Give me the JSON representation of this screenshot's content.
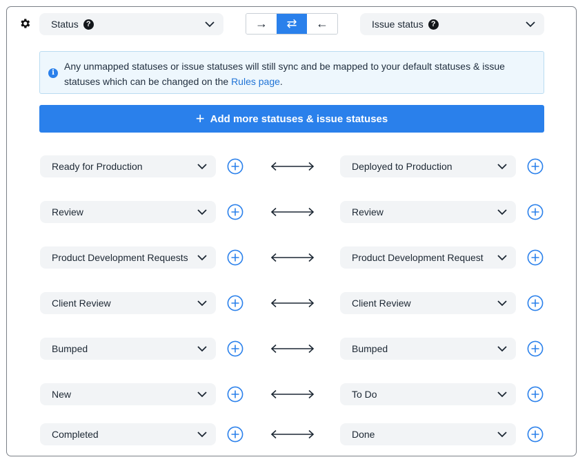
{
  "header": {
    "left_field": {
      "label": "Status",
      "help": "?"
    },
    "right_field": {
      "label": "Issue status",
      "help": "?"
    },
    "direction_buttons": [
      {
        "glyph": "→",
        "name": "one-way-right"
      },
      {
        "glyph": "⇄",
        "name": "two-way"
      },
      {
        "glyph": "←",
        "name": "one-way-left"
      }
    ]
  },
  "info": {
    "icon": "i",
    "text": "Any unmapped statuses or issue statuses will still sync and be mapped to your default statuses & issue statuses which can be changed on the ",
    "link": "Rules page",
    "suffix": "."
  },
  "add_button": {
    "plus": "+",
    "label": "Add more statuses & issue statuses"
  },
  "mappings": [
    {
      "left": "Ready for Production",
      "right": "Deployed to Production"
    },
    {
      "left": "Review",
      "right": "Review"
    },
    {
      "left": "Product Development Requests",
      "right": "Product Development Request"
    },
    {
      "left": "Client Review",
      "right": "Client Review"
    },
    {
      "left": "Bumped",
      "right": "Bumped"
    },
    {
      "left": "New",
      "right": "To Do"
    },
    {
      "left": "Completed",
      "right": "Done"
    }
  ],
  "colors": {
    "accent": "#2a80eb",
    "select_bg": "#f2f4f6",
    "info_bg": "#eef7fd"
  }
}
